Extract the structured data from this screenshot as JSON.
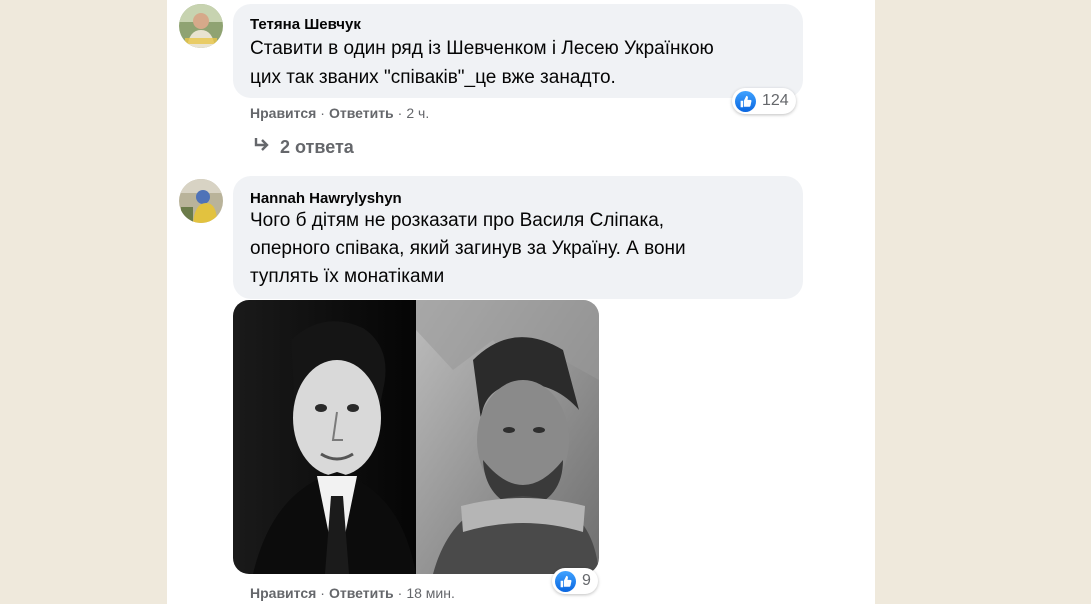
{
  "comments": [
    {
      "author": "Тетяна Шевчук",
      "lines": [
        "Ставити в один ряд із Шевченком і Лесею Українкою",
        "цих так званих \"співаків\"_це вже занадто."
      ],
      "reaction_count": "124",
      "like_label": "Нравится",
      "reply_label": "Ответить",
      "time": "2 ч.",
      "replies_label": "2 ответа"
    },
    {
      "author": "Hannah Hawrylyshyn",
      "lines": [
        "Чого б дітям не розказати про Василя Сліпака,",
        "оперного співака, який загинув за Україну. А вони",
        "туплять їх монатіками"
      ],
      "reaction_count": "9",
      "like_label": "Нравится",
      "reply_label": "Ответить",
      "time": "18 мин."
    }
  ],
  "colors": {
    "page_background": "#efe9dc",
    "bubble": "#f0f2f5",
    "like_blue": "#1877f2",
    "meta_text": "#65676b"
  },
  "icons": {
    "reaction": "like-thumb-icon",
    "replies": "reply-arrow-icon"
  }
}
